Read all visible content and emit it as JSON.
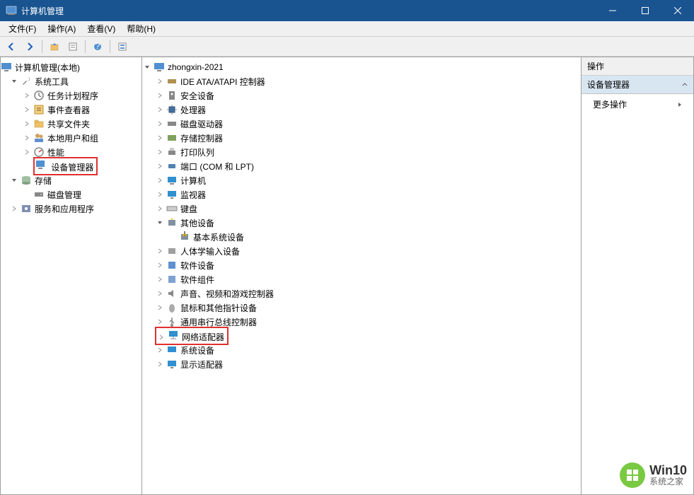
{
  "window": {
    "title": "计算机管理"
  },
  "menu": {
    "file": "文件(F)",
    "action": "操作(A)",
    "view": "查看(V)",
    "help": "帮助(H)"
  },
  "left_tree": {
    "root": "计算机管理(本地)",
    "system_tools": "系统工具",
    "task_scheduler": "任务计划程序",
    "event_viewer": "事件查看器",
    "shared_folders": "共享文件夹",
    "local_users": "本地用户和组",
    "performance": "性能",
    "device_manager": "设备管理器",
    "storage": "存储",
    "disk_mgmt": "磁盘管理",
    "services_apps": "服务和应用程序"
  },
  "mid_tree": {
    "computer": "zhongxin-2021",
    "ide": "IDE ATA/ATAPI 控制器",
    "security": "安全设备",
    "processor": "处理器",
    "disk_drive": "磁盘驱动器",
    "storage_ctrl": "存储控制器",
    "print_queue": "打印队列",
    "ports": "端口 (COM 和 LPT)",
    "computer_cat": "计算机",
    "monitor": "监视器",
    "keyboard": "键盘",
    "other": "其他设备",
    "basic_sys": "基本系统设备",
    "hid": "人体学输入设备",
    "software_dev": "软件设备",
    "software_comp": "软件组件",
    "sound": "声音、视频和游戏控制器",
    "mouse": "鼠标和其他指针设备",
    "usb": "通用串行总线控制器",
    "network": "网络适配器",
    "system_dev": "系统设备",
    "display": "显示适配器"
  },
  "actions": {
    "header": "操作",
    "group": "设备管理器",
    "more": "更多操作"
  },
  "watermark": {
    "line1": "Win10",
    "line2": "系统之家"
  }
}
